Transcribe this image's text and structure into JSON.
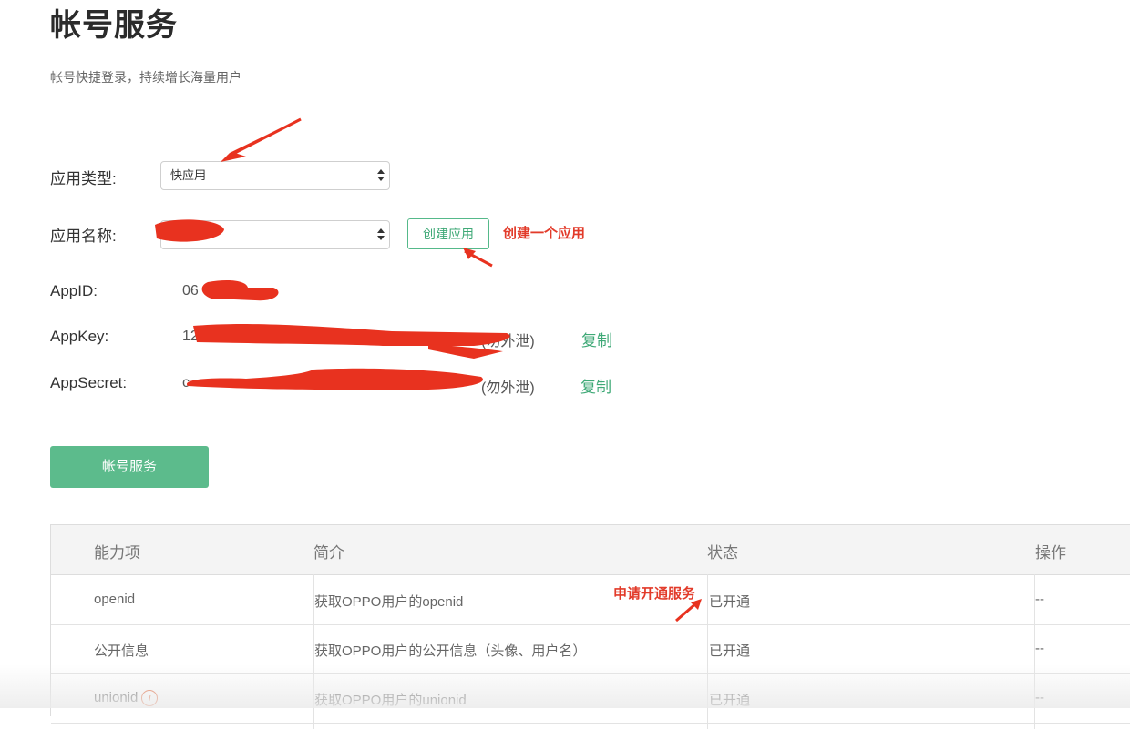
{
  "page": {
    "title": "帐号服务",
    "subtitle": "帐号快捷登录，持续增长海量用户"
  },
  "form": {
    "app_type_label": "应用类型:",
    "app_type_value": "快应用",
    "app_name_label": "应用名称:",
    "app_name_value": "",
    "create_app_button": "创建应用"
  },
  "credentials": {
    "appid_label": "AppID:",
    "appid_value": "06",
    "appkey_label": "AppKey:",
    "appkey_value": "12",
    "appkey_note": "(勿外泄)",
    "appsecret_label": "AppSecret:",
    "appsecret_value": "c",
    "appsecret_note": "(勿外泄)",
    "copy_label": "复制"
  },
  "account_service_button": "帐号服务",
  "table": {
    "headers": [
      "能力项",
      "简介",
      "状态",
      "操作"
    ],
    "rows": [
      {
        "ability": "openid",
        "desc": "获取OPPO用户的openid",
        "status": "已开通",
        "action": "--"
      },
      {
        "ability": "公开信息",
        "desc": "获取OPPO用户的公开信息（头像、用户名）",
        "status": "已开通",
        "action": "--"
      },
      {
        "ability": "unionid",
        "desc": "获取OPPO用户的unionid",
        "status": "已开通",
        "action": "--"
      }
    ]
  },
  "annotations": {
    "create_app": "创建一个应用",
    "apply_service": "申请开通服务"
  },
  "colors": {
    "accent": "#5cbb8c",
    "link": "#3fa977",
    "annotation": "#e23b2a"
  }
}
